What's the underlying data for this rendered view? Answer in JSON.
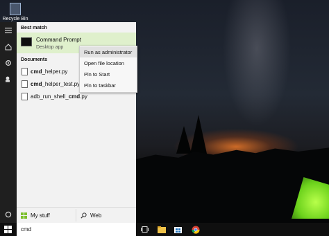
{
  "desktop": {
    "recycle_bin_label": "Recycle Bin"
  },
  "start_menu": {
    "best_match_header": "Best match",
    "best_match": {
      "title": "Command Prompt",
      "subtitle": "Desktop app"
    },
    "documents_header": "Documents",
    "documents": [
      {
        "bold": "cmd",
        "rest": "_helper.py"
      },
      {
        "bold": "cmd",
        "rest": "_helper_test.py"
      },
      {
        "prefix": "adb_run_shell_",
        "bold": "cmd",
        "rest": ".py"
      }
    ],
    "footer": {
      "my_stuff": "My stuff",
      "web": "Web"
    }
  },
  "context_menu": {
    "items": [
      "Run as administrator",
      "Open file location",
      "Pin to Start",
      "Pin to taskbar"
    ],
    "highlighted_index": 0
  },
  "taskbar": {
    "search_value": "cmd"
  },
  "colors": {
    "best_match_bg": "#dff0cc",
    "panel_bg": "#f2f2f2",
    "taskbar_bg": "#0f0f0f",
    "tent_green": "#6cd21c",
    "windows_logo": "#ffffff"
  }
}
